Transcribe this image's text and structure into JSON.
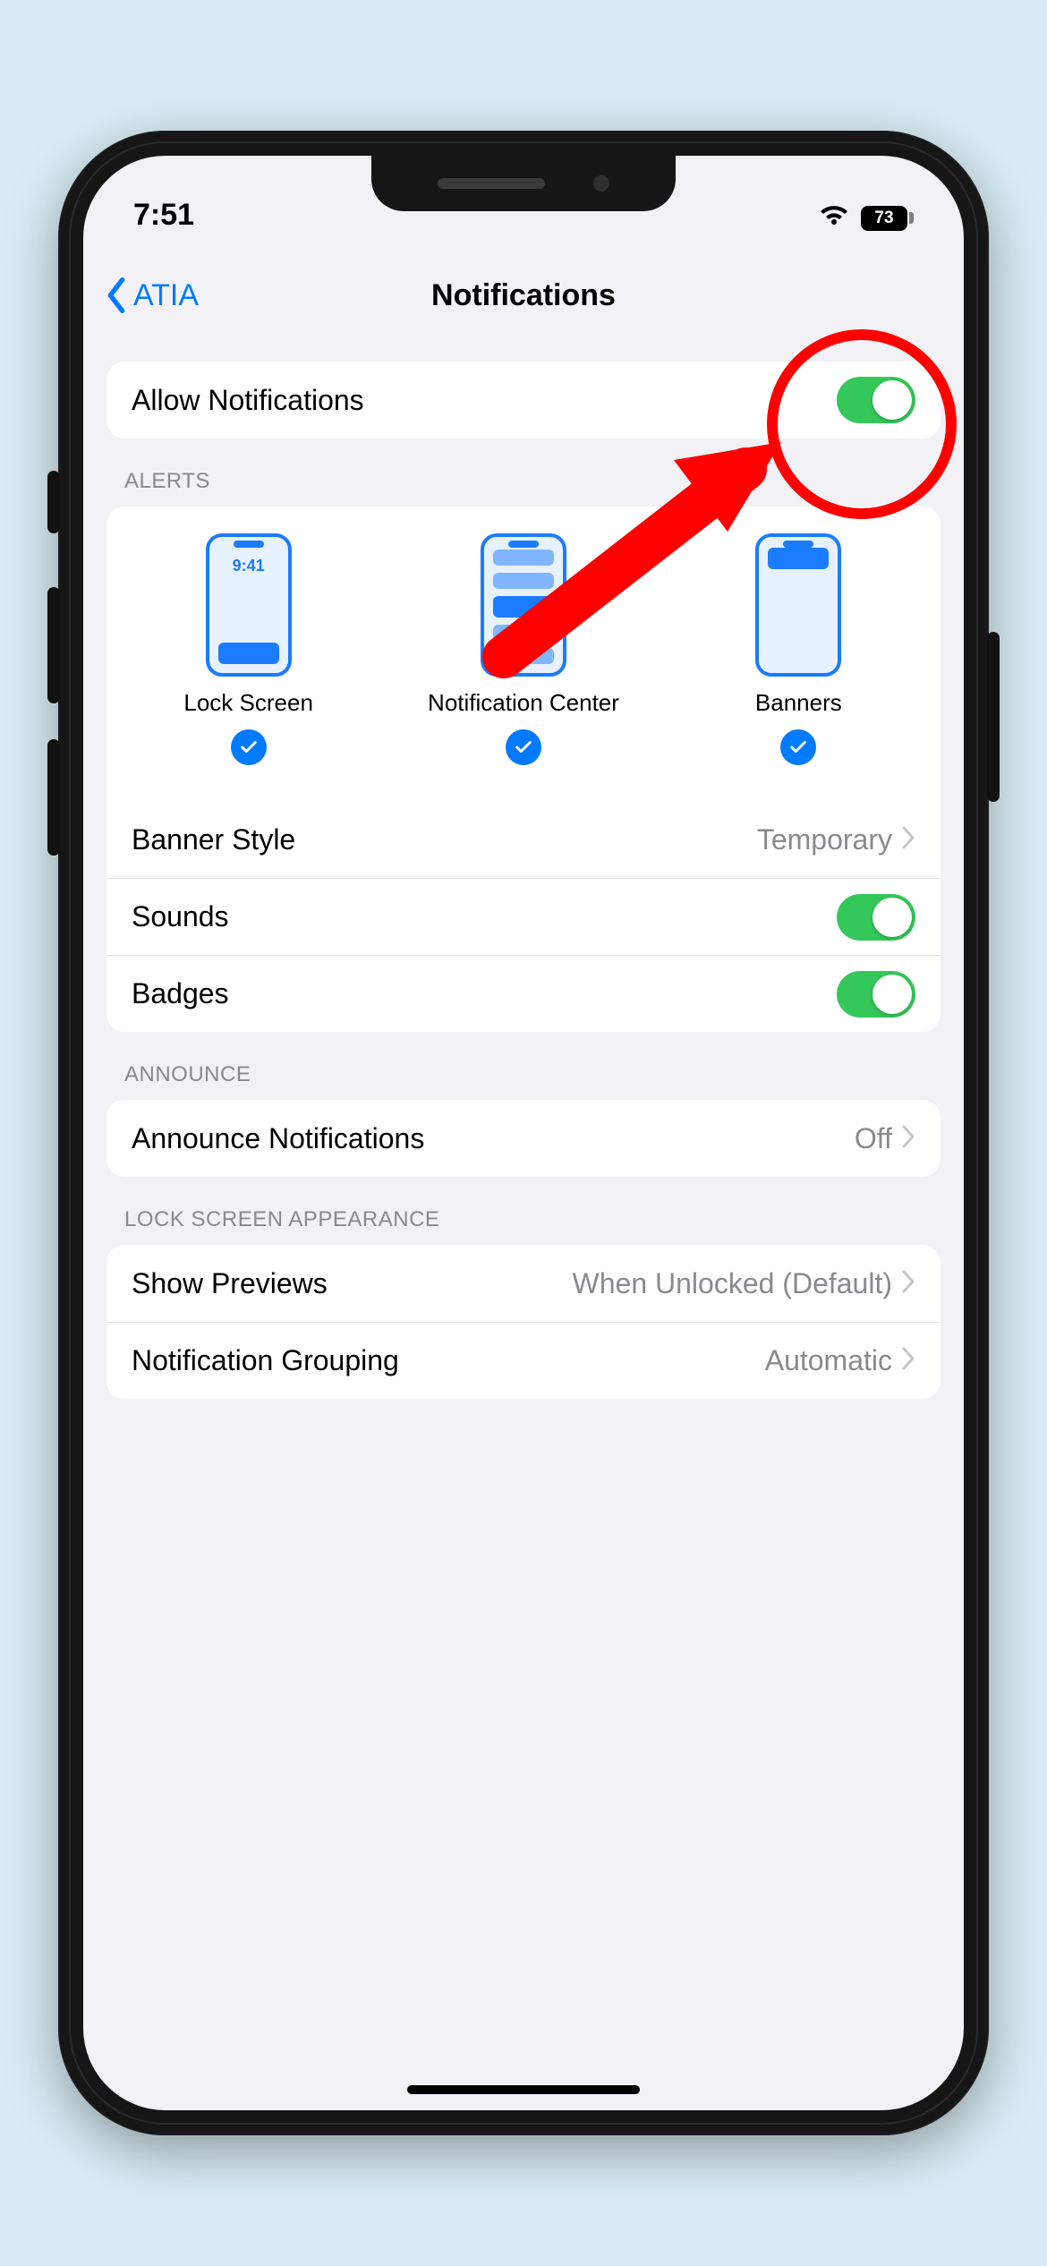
{
  "status": {
    "time": "7:51",
    "battery": "73"
  },
  "nav": {
    "back_label": "ATIA",
    "title": "Notifications"
  },
  "allow": {
    "label": "Allow Notifications",
    "on": true
  },
  "alerts": {
    "header": "ALERTS",
    "lock_time": "9:41",
    "options": {
      "lock": "Lock Screen",
      "center": "Notification Center",
      "banners": "Banners"
    },
    "banner_style": {
      "label": "Banner Style",
      "value": "Temporary"
    },
    "sounds": {
      "label": "Sounds",
      "on": true
    },
    "badges": {
      "label": "Badges",
      "on": true
    }
  },
  "announce": {
    "header": "ANNOUNCE",
    "row": {
      "label": "Announce Notifications",
      "value": "Off"
    }
  },
  "lockscreen": {
    "header": "LOCK SCREEN APPEARANCE",
    "previews": {
      "label": "Show Previews",
      "value": "When Unlocked (Default)"
    },
    "grouping": {
      "label": "Notification Grouping",
      "value": "Automatic"
    }
  }
}
